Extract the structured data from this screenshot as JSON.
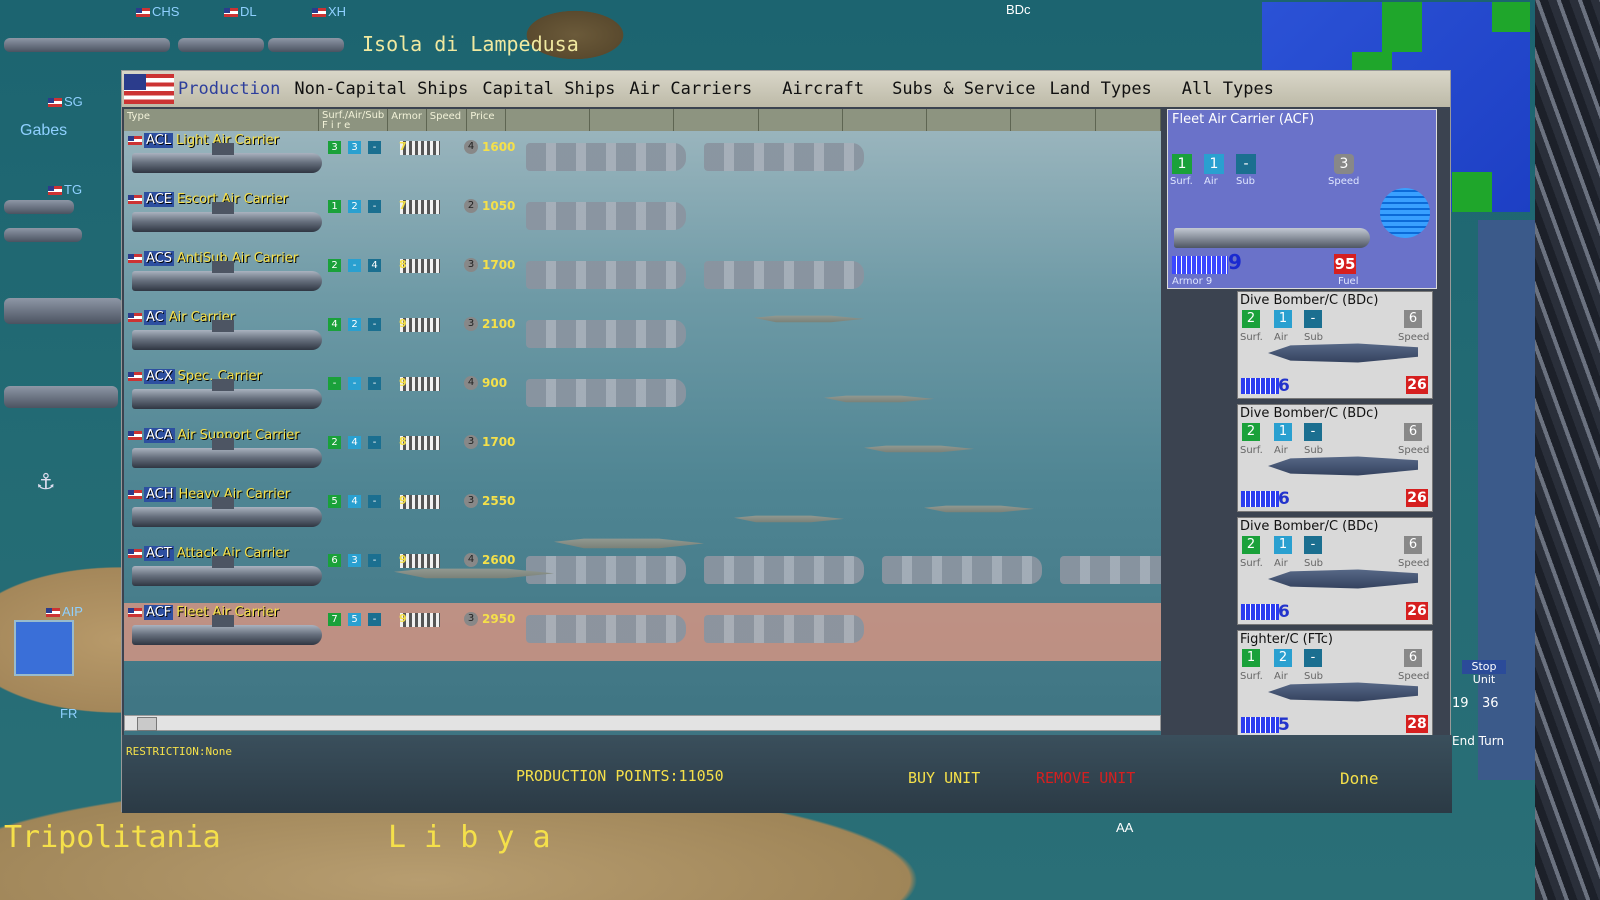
{
  "map": {
    "island_label": "Isola di Lampedusa",
    "region_label": "Tripolitania",
    "country_label": "L i b y a",
    "units_left": [
      {
        "label": "CHS"
      },
      {
        "label": "DL"
      },
      {
        "label": "XH"
      },
      {
        "label": "SG"
      },
      {
        "label": "Gabes"
      },
      {
        "label": "TG"
      },
      {
        "label": "AIP"
      },
      {
        "label": "FR"
      }
    ],
    "unit_top_right": "BDc",
    "unit_bottom": "AA",
    "right_buttons": {
      "stop_unit": "Stop Unit",
      "end_turn": "End Turn",
      "date_a": "19",
      "date_b": "36"
    }
  },
  "window": {
    "tabs": [
      "Production",
      "Non-Capital Ships",
      "Capital Ships",
      "Air Carriers",
      "Aircraft",
      "Subs & Service",
      "Land Types",
      "All Types"
    ],
    "active_tab": "Production",
    "columns": [
      "Type",
      "Surf./Air/Sub\nF i r e",
      "Armor",
      "Speed",
      "Price"
    ],
    "rows": [
      {
        "code": "ACL",
        "name": "Light Air Carrier",
        "surf": "3",
        "air": "3",
        "sub": "-",
        "armor": "7",
        "speed": "4",
        "price": "1600",
        "variants": 2
      },
      {
        "code": "ACE",
        "name": "Escort Air Carrier",
        "surf": "1",
        "air": "2",
        "sub": "-",
        "armor": "7",
        "speed": "2",
        "price": "1050",
        "variants": 1
      },
      {
        "code": "ACS",
        "name": "AntiSub Air Carrier",
        "surf": "2",
        "air": "-",
        "sub": "4",
        "armor": "8",
        "speed": "3",
        "price": "1700",
        "variants": 2
      },
      {
        "code": "AC",
        "name": "Air Carrier",
        "surf": "4",
        "air": "2",
        "sub": "-",
        "armor": "9",
        "speed": "3",
        "price": "2100",
        "variants": 1
      },
      {
        "code": "ACX",
        "name": "Spec. Carrier",
        "surf": "-",
        "air": "-",
        "sub": "-",
        "armor": "9",
        "speed": "4",
        "price": "900",
        "variants": 1
      },
      {
        "code": "ACA",
        "name": "Air Support Carrier",
        "surf": "2",
        "air": "4",
        "sub": "-",
        "armor": "8",
        "speed": "3",
        "price": "1700",
        "variants": 0
      },
      {
        "code": "ACH",
        "name": "Heavy Air Carrier",
        "surf": "5",
        "air": "4",
        "sub": "-",
        "armor": "9",
        "speed": "3",
        "price": "2550",
        "variants": 0
      },
      {
        "code": "ACT",
        "name": "Attack Air Carrier",
        "surf": "6",
        "air": "3",
        "sub": "-",
        "armor": "9",
        "speed": "4",
        "price": "2600",
        "variants": 4
      },
      {
        "code": "ACF",
        "name": "Fleet Air Carrier",
        "surf": "7",
        "air": "5",
        "sub": "-",
        "armor": "9",
        "speed": "3",
        "price": "2950",
        "variants": 2,
        "selected": true
      }
    ],
    "detail": {
      "title": "Fleet Air Carrier (ACF)",
      "surf": "1",
      "air": "1",
      "sub": "-",
      "speed": "3",
      "surf_label": "Surf.",
      "air_label": "Air",
      "sub_label": "Sub",
      "speed_label": "Speed",
      "armor_value": "9",
      "armor_label": "Armor 9",
      "fuel_value": "95",
      "fuel_label": "Fuel"
    },
    "cards": [
      {
        "title": "Dive Bomber/C  (BDc)",
        "surf": "2",
        "air": "1",
        "sub": "-",
        "speed": "6",
        "armor": "6",
        "fuel": "26"
      },
      {
        "title": "Dive Bomber/C  (BDc)",
        "surf": "2",
        "air": "1",
        "sub": "-",
        "speed": "6",
        "armor": "6",
        "fuel": "26"
      },
      {
        "title": "Dive Bomber/C  (BDc)",
        "surf": "2",
        "air": "1",
        "sub": "-",
        "speed": "6",
        "armor": "6",
        "fuel": "26"
      },
      {
        "title": "Fighter/C  (FTc)",
        "surf": "1",
        "air": "2",
        "sub": "-",
        "speed": "6",
        "armor": "5",
        "fuel": "28"
      }
    ],
    "card_labels": {
      "surf": "Surf.",
      "air": "Air",
      "sub": "Sub",
      "speed": "Speed"
    },
    "restriction": "RESTRICTION:None",
    "production_points": "PRODUCTION POINTS:11050",
    "buy_unit": "BUY UNIT",
    "remove_unit": "REMOVE UNIT",
    "done": "Done"
  },
  "colors": {
    "accent_yellow": "#f5e04a",
    "remove_red": "#d61f1f",
    "tab_active": "#2d3e9c"
  }
}
